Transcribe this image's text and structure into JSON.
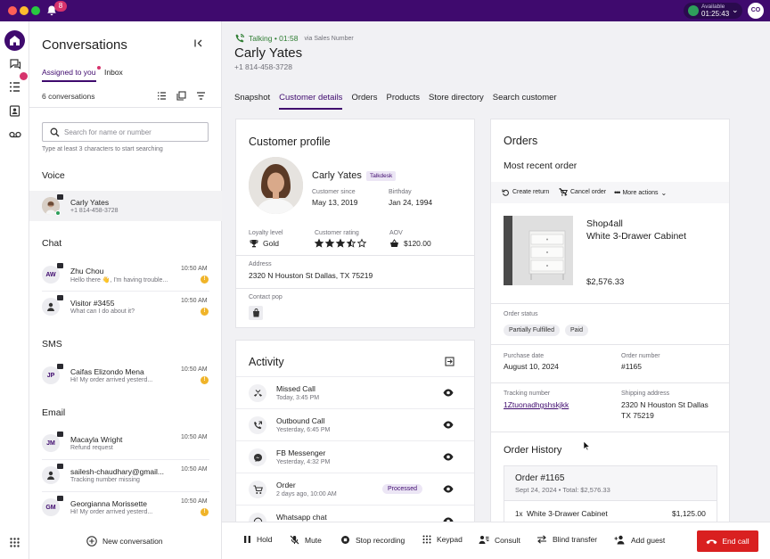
{
  "topbar": {
    "notification_count": "8",
    "status_label": "Available",
    "status_timer": "01:25:43",
    "user_initials": "CO"
  },
  "conversations": {
    "title": "Conversations",
    "tabs": [
      {
        "label": "Assigned to you"
      },
      {
        "label": "Inbox"
      }
    ],
    "count": "6 conversations",
    "search_placeholder": "Search for name or number",
    "search_hint": "Type at least 3 characters to start searching",
    "voice": {
      "heading": "Voice",
      "items": [
        {
          "name": "Carly Yates",
          "sub": "+1 814-458-3728"
        }
      ]
    },
    "chat": {
      "heading": "Chat",
      "items": [
        {
          "initials": "AW",
          "name": "Zhu Chou",
          "sub": "Hello there 👋, I'm having trouble...",
          "time": "10:50 AM",
          "warn": "!"
        },
        {
          "name": "Visitor #3455",
          "sub": "What can I do about it?",
          "time": "10:50 AM",
          "warn": "!"
        }
      ]
    },
    "sms": {
      "heading": "SMS",
      "items": [
        {
          "initials": "JP",
          "name": "Caifas Elizondo Mena",
          "sub": "Hi! My order arrived yesterd...",
          "time": "10:50 AM",
          "warn": "!"
        }
      ]
    },
    "email": {
      "heading": "Email",
      "items": [
        {
          "initials": "JM",
          "name": "Macayla Wright",
          "sub": "Refund request",
          "time": "10:50 AM"
        },
        {
          "name": "sailesh-chaudhary@gmail...",
          "sub": "Tracking number missing",
          "time": "10:50 AM"
        },
        {
          "initials": "GM",
          "name": "Georgianna Morissette",
          "sub": "Hi! My order arrived yesterd...",
          "time": "10:50 AM",
          "warn": "!"
        }
      ]
    },
    "new_conversation": "New conversation"
  },
  "call": {
    "status": "Talking • 01:58",
    "via": "via Sales Number",
    "name": "Carly Yates",
    "phone": "+1 814-458-3728"
  },
  "tabs": [
    {
      "label": "Snapshot"
    },
    {
      "label": "Customer details"
    },
    {
      "label": "Orders"
    },
    {
      "label": "Products"
    },
    {
      "label": "Store directory"
    },
    {
      "label": "Search customer"
    }
  ],
  "profile": {
    "title": "Customer profile",
    "name": "Carly Yates",
    "tag": "Talkdesk",
    "customer_since_label": "Customer since",
    "customer_since": "May 13, 2019",
    "birthday_label": "Birthday",
    "birthday": "Jan 24, 1994",
    "loyalty_label": "Loyalty level",
    "loyalty": "Gold",
    "rating_label": "Customer rating",
    "rating": 3.5,
    "rating_max": 5,
    "aov_label": "AOV",
    "aov": "$120.00",
    "address_label": "Address",
    "address": "2320 N Houston St Dallas, TX 75219",
    "contact_label": "Contact pop"
  },
  "activity": {
    "title": "Activity",
    "items": [
      {
        "title": "Missed Call",
        "sub": "Today, 3:45 PM",
        "icon": "missed-call-icon"
      },
      {
        "title": "Outbound Call",
        "sub": "Yesterday, 6:45 PM",
        "icon": "outbound-call-icon"
      },
      {
        "title": "FB Messenger",
        "sub": "Yesterday, 4:32 PM",
        "icon": "messenger-icon"
      },
      {
        "title": "Order",
        "sub": "2 days ago, 10:00 AM",
        "badge": "Processed",
        "icon": "cart-icon"
      },
      {
        "title": "Whatsapp chat",
        "sub": "",
        "icon": "whatsapp-icon"
      }
    ]
  },
  "orders": {
    "title": "Orders",
    "subtitle": "Most recent order",
    "actions": [
      {
        "label": "Create return"
      },
      {
        "label": "Cancel order"
      },
      {
        "label": "More actions"
      }
    ],
    "store": "Shop4all",
    "product": "White 3-Drawer Cabinet",
    "price": "$2,576.33",
    "status_label": "Order status",
    "status_chips": [
      "Partially Fulfilled",
      "Paid"
    ],
    "purchase_label": "Purchase date",
    "purchase_date": "August 10, 2024",
    "number_label": "Order number",
    "number": "#1165",
    "tracking_label": "Tracking number",
    "tracking": "1Ztuonadhgshskjkk",
    "shipping_label": "Shipping address",
    "shipping_line1": "2320 N Houston St Dallas",
    "shipping_line2": "TX 75219",
    "history_title": "Order History",
    "history": {
      "order": "Order #1165",
      "meta": "Sept 24, 2024 • Total: $2,576.33",
      "qty": "1x",
      "item": "White 3-Drawer Cabinet",
      "amount": "$1,125.00"
    }
  },
  "callbar": {
    "hold": "Hold",
    "mute": "Mute",
    "stop_recording": "Stop recording",
    "keypad": "Keypad",
    "consult": "Consult",
    "blind_transfer": "Blind transfer",
    "add_guest": "Add guest",
    "end_call": "End call"
  },
  "colors": {
    "brand": "#3f0a6e",
    "end_call": "#d92020",
    "talking": "#2e7d32"
  }
}
